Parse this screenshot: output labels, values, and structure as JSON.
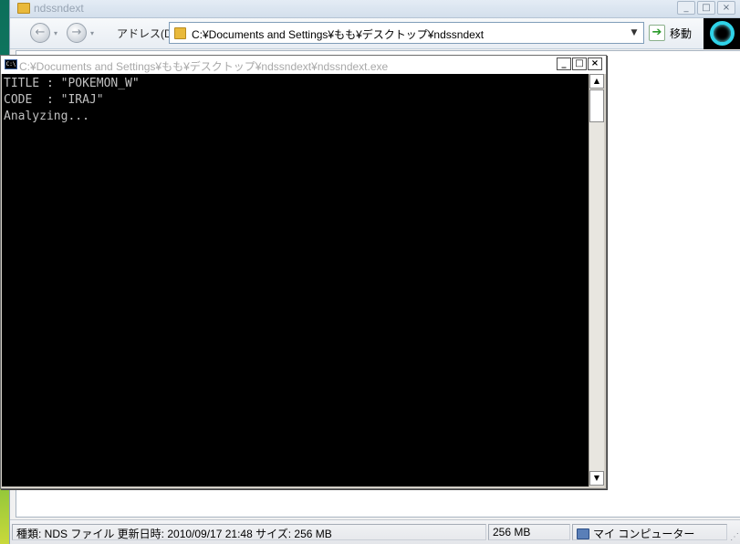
{
  "explorer": {
    "title": "ndssndext",
    "address_label": "アドレス(D)",
    "address_value": "C:¥Documents and Settings¥もも¥デスクトップ¥ndssndext",
    "go_label": "移動",
    "win_buttons": {
      "minimize": "_",
      "maximize": "□",
      "close": "×"
    },
    "status": {
      "info": "種類: NDS ファイル 更新日時: 2010/09/17 21:48 サイズ: 256 MB",
      "size": "256 MB",
      "location": "マイ コンピューター"
    }
  },
  "console": {
    "title": "C:¥Documents and Settings¥もも¥デスクトップ¥ndssndext¥ndssndext.exe",
    "icon_text": "C:\\",
    "win_buttons": {
      "minimize": "_",
      "maximize": "□",
      "close": "×"
    },
    "lines": [
      "TITLE : \"POKEMON_W\"",
      "CODE  : \"IRAJ\"",
      "Analyzing..."
    ]
  },
  "icons": [
    "folder-icon",
    "back-arrow-icon",
    "forward-arrow-icon",
    "go-arrow-icon",
    "throbber-icon",
    "console-icon",
    "computer-icon"
  ]
}
